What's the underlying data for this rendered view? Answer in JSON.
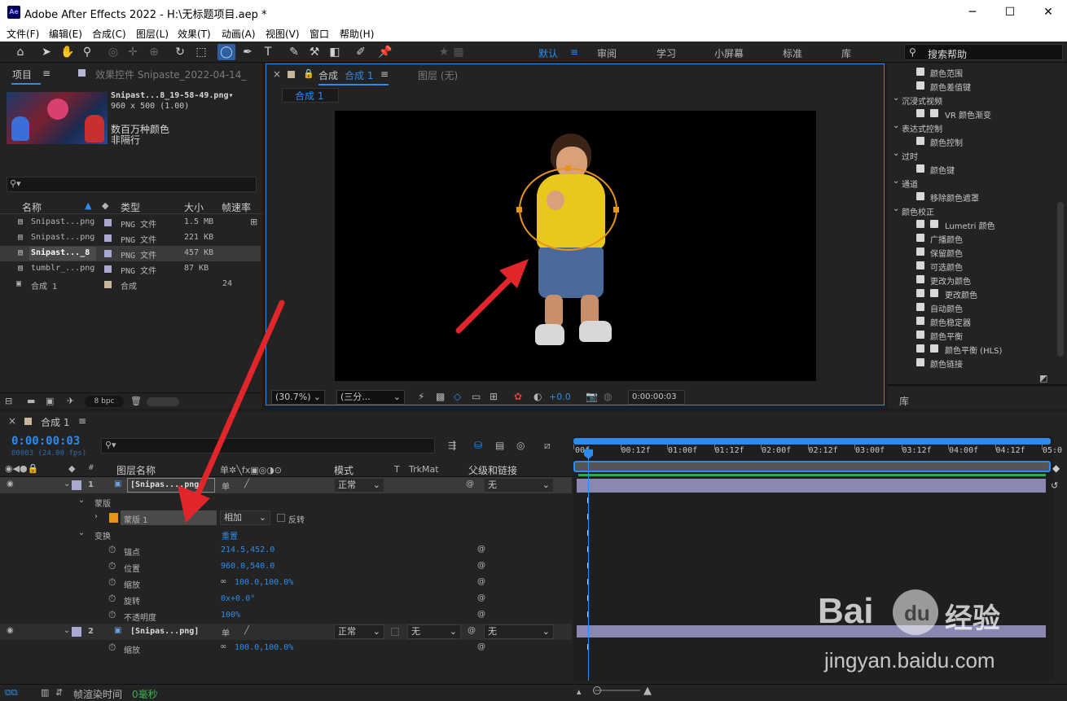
{
  "window": {
    "title": "Adobe After Effects 2022 - H:\\无标题项目.aep *",
    "logo": "Ae",
    "minimize": "─",
    "maximize": "☐",
    "close": "✕"
  },
  "menu": [
    "文件(F)",
    "编辑(E)",
    "合成(C)",
    "图层(L)",
    "效果(T)",
    "动画(A)",
    "视图(V)",
    "窗口",
    "帮助(H)"
  ],
  "workspaces": {
    "active": "默认",
    "items": [
      "审阅",
      "学习",
      "小屏幕",
      "标准",
      "库"
    ]
  },
  "search_help": "搜索帮助",
  "project": {
    "tab": "项目",
    "effects_tab": "效果控件 Snipaste_2022-04-14_",
    "preview": {
      "name": "Snipast...8_19-58-49.png▾",
      "size": "960 x 500 (1.00)",
      "colors": "数百万种颜色",
      "interlace": "非隔行"
    },
    "columns": [
      "名称",
      "类型",
      "大小",
      "帧速率"
    ],
    "items": [
      {
        "name": "Snipast...png",
        "type": "PNG 文件",
        "size": "1.5 MB",
        "fps": ""
      },
      {
        "name": "Snipast...png",
        "type": "PNG 文件",
        "size": "221 KB",
        "fps": ""
      },
      {
        "name": "Snipast..._8",
        "type": "PNG 文件",
        "size": "457 KB",
        "fps": ""
      },
      {
        "name": "tumblr_...png",
        "type": "PNG 文件",
        "size": "87 KB",
        "fps": ""
      },
      {
        "name": "合成 1",
        "type": "合成",
        "size": "",
        "fps": "24"
      }
    ],
    "bpc": "8 bpc"
  },
  "comp": {
    "tab": "合成",
    "tab_name": "合成 1",
    "layer_tab": "图层  (无)",
    "subtab": "合成 1",
    "zoom": "(30.7%)",
    "resolution": "(三分...",
    "exposure": "+0.0",
    "timecode": "0:00:00:03"
  },
  "effects": [
    {
      "k": "i",
      "t": "颜色范围"
    },
    {
      "k": "i",
      "t": "颜色差值键"
    },
    {
      "k": "c",
      "t": "沉浸式视频"
    },
    {
      "k": "i2",
      "t": "VR 颜色渐变"
    },
    {
      "k": "c",
      "t": "表达式控制"
    },
    {
      "k": "i",
      "t": "颜色控制"
    },
    {
      "k": "c",
      "t": "过时"
    },
    {
      "k": "i",
      "t": "颜色键"
    },
    {
      "k": "c",
      "t": "通道"
    },
    {
      "k": "i",
      "t": "移除颜色遮罩"
    },
    {
      "k": "c",
      "t": "颜色校正"
    },
    {
      "k": "i2",
      "t": "Lumetri 颜色"
    },
    {
      "k": "i",
      "t": "广播颜色"
    },
    {
      "k": "i",
      "t": "保留颜色"
    },
    {
      "k": "i",
      "t": "可选颜色"
    },
    {
      "k": "i",
      "t": "更改为颜色"
    },
    {
      "k": "i2",
      "t": "更改颜色"
    },
    {
      "k": "i",
      "t": "自动颜色"
    },
    {
      "k": "i",
      "t": "颜色稳定器"
    },
    {
      "k": "i",
      "t": "颜色平衡"
    },
    {
      "k": "i2",
      "t": "颜色平衡 (HLS)"
    },
    {
      "k": "i",
      "t": "颜色链接"
    }
  ],
  "library_tab": "库",
  "timeline": {
    "tab": "合成 1",
    "time": "0:00:00:03",
    "frames": "00003 (24.00 fps)",
    "columns": {
      "name": "图层名称",
      "mode": "模式",
      "t": "T",
      "trkmat": "TrkMat",
      "parent": "父级和链接"
    },
    "ruler": [
      "00f",
      "00:12f",
      "01:00f",
      "01:12f",
      "02:00f",
      "02:12f",
      "03:00f",
      "03:12f",
      "04:00f",
      "04:12f",
      "05:0"
    ],
    "layer1": {
      "num": "1",
      "name": "[Snipas....png]",
      "mode": "正常",
      "parent": "无"
    },
    "mask_group": "蒙版",
    "mask": {
      "name": "蒙版 1",
      "mode": "相加",
      "invert": "反转"
    },
    "transform": {
      "label": "变换",
      "reset": "重置"
    },
    "props": [
      {
        "n": "锚点",
        "v": "214.5,452.0"
      },
      {
        "n": "位置",
        "v": "960.0,540.0"
      },
      {
        "n": "缩放",
        "v": "100.0,100.0%"
      },
      {
        "n": "旋转",
        "v": "0x+0.0°"
      },
      {
        "n": "不透明度",
        "v": "100%"
      }
    ],
    "layer2": {
      "num": "2",
      "name": "[Snipas...png]",
      "mode": "正常",
      "trkmat": "无",
      "parent": "无",
      "prop": "缩放",
      "val": "100.0,100.0%"
    },
    "render_label": "帧渲染时间",
    "render_val": "0毫秒"
  },
  "watermark": {
    "brand": "Bai",
    "brand2": "du",
    "jy": "经验",
    "url": "jingyan.baidu.com"
  }
}
